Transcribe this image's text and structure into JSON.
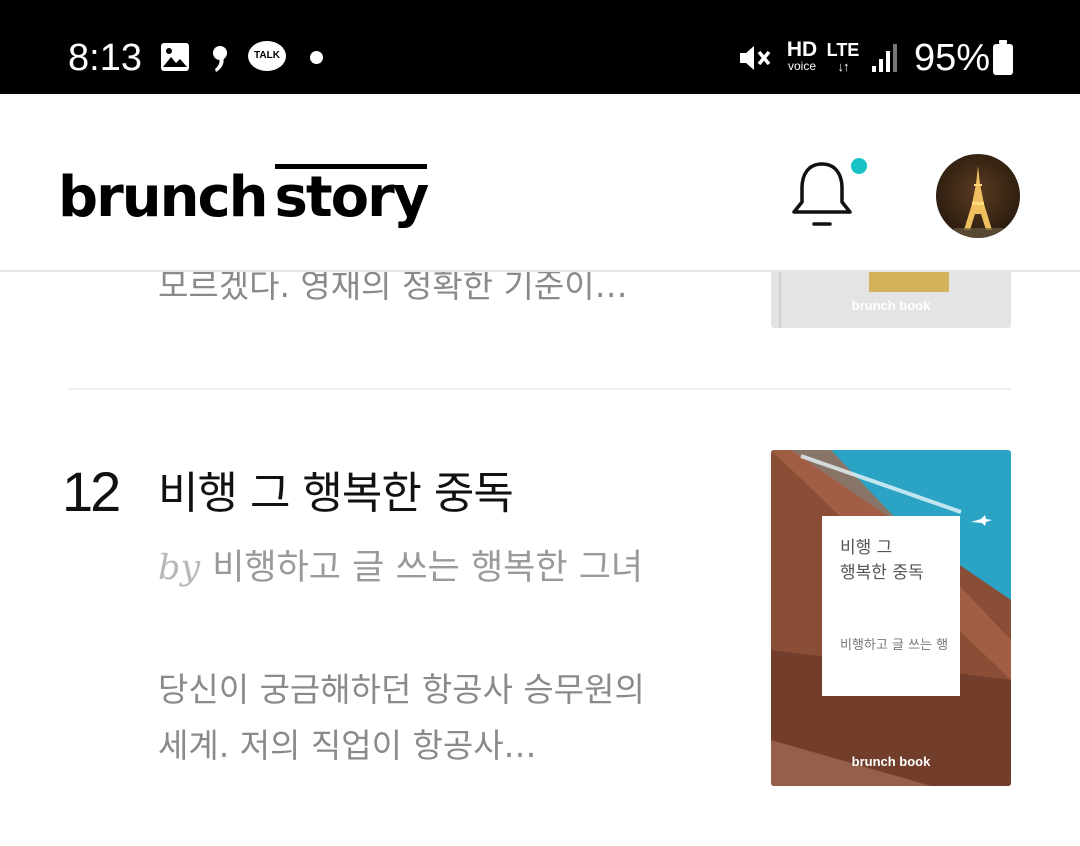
{
  "status_bar": {
    "time": "8:13",
    "hd_top": "HD",
    "hd_bottom": "voice",
    "network": "LTE",
    "network_arrows": "↓↑",
    "battery": "95%",
    "talk_label": "TALK",
    "icons": [
      "gallery-icon",
      "comma-icon",
      "kakaotalk-icon",
      "dot-icon",
      "mute-icon",
      "hd-voice-icon",
      "lte-icon",
      "signal-icon",
      "battery-icon"
    ]
  },
  "header": {
    "logo_part1": "brunch",
    "logo_part2": "story",
    "notification_dot_color": "#16c2c5"
  },
  "previous_item": {
    "description_tail": "모르겠다. 영재의 정확한 기준이…",
    "cover_brand": "brunch book"
  },
  "item": {
    "rank": "12",
    "title": "비행 그 행복한 중독",
    "by_label": "by",
    "author": "비행하고 글 쓰는 행복한 그녀",
    "description_line1": "당신이 궁금해하던 항공사 승무원의",
    "description_line2": "세계. 저의 직업이 항공사…",
    "cover": {
      "title_line1": "비행 그",
      "title_line2": "행복한 중독",
      "author": "비행하고 글 쓰는 행",
      "brand": "brunch book",
      "sky_color": "#2aa3c4",
      "wall_color": "#8a4d36"
    }
  }
}
